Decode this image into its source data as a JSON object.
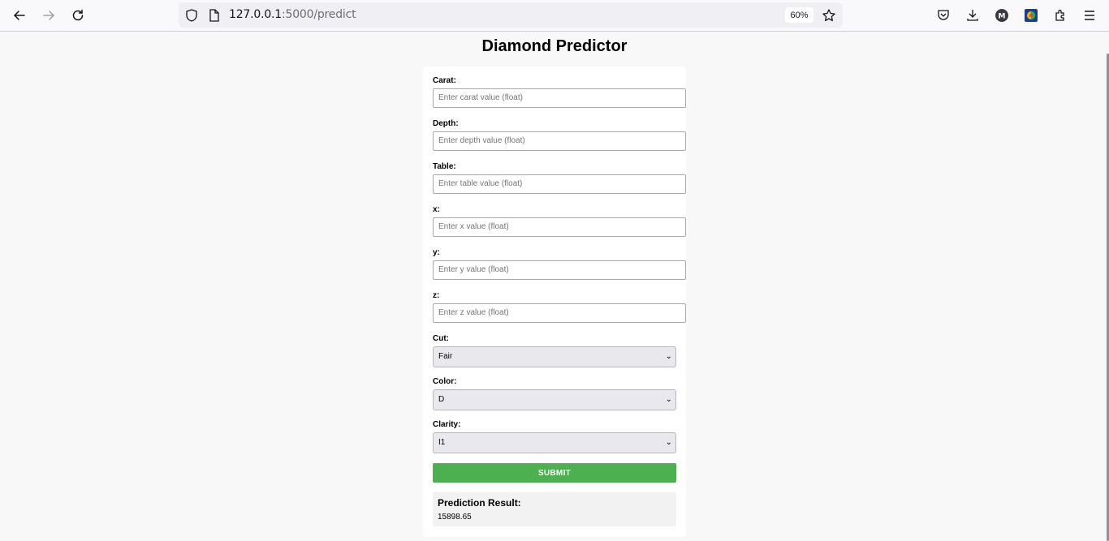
{
  "browser": {
    "url_host": "127.0.0.1",
    "url_path": ":5000/predict",
    "zoom": "60%"
  },
  "page": {
    "title": "Diamond Predictor"
  },
  "form": {
    "carat": {
      "label": "Carat:",
      "placeholder": "Enter carat value (float)"
    },
    "depth": {
      "label": "Depth:",
      "placeholder": "Enter depth value (float)"
    },
    "table": {
      "label": "Table:",
      "placeholder": "Enter table value (float)"
    },
    "x": {
      "label": "x:",
      "placeholder": "Enter x value (float)"
    },
    "y": {
      "label": "y:",
      "placeholder": "Enter y value (float)"
    },
    "z": {
      "label": "z:",
      "placeholder": "Enter z value (float)"
    },
    "cut": {
      "label": "Cut:",
      "selected": "Fair"
    },
    "color": {
      "label": "Color:",
      "selected": "D"
    },
    "clarity": {
      "label": "Clarity:",
      "selected": "I1"
    },
    "submit_label": "SUBMIT"
  },
  "result": {
    "title": "Prediction Result:",
    "value": "15898.65"
  },
  "colors": {
    "submit": "#4caf50",
    "page_bg": "#f8f8f8"
  }
}
